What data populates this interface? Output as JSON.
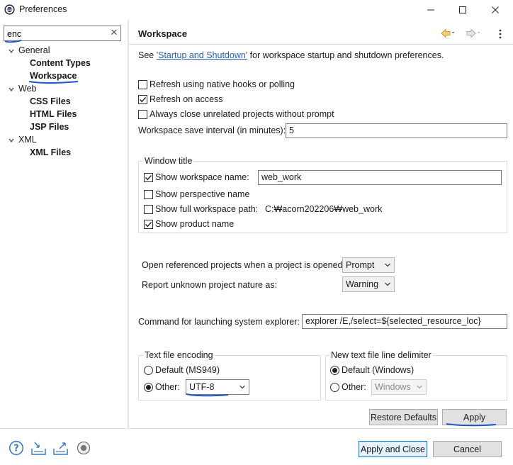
{
  "window": {
    "title": "Preferences",
    "controls": {
      "minimize": "minimize",
      "maximize": "maximize",
      "close": "close"
    }
  },
  "sidebar": {
    "filter_value": "enc",
    "tree": [
      {
        "label": "General",
        "expanded": true,
        "children": [
          "Content Types",
          "Workspace"
        ]
      },
      {
        "label": "Web",
        "expanded": true,
        "children": [
          "CSS Files",
          "HTML Files",
          "JSP Files"
        ]
      },
      {
        "label": "XML",
        "expanded": true,
        "children": [
          "XML Files"
        ]
      }
    ],
    "selected": "Workspace"
  },
  "page": {
    "title": "Workspace",
    "description": {
      "prefix": "See ",
      "link": "'Startup and Shutdown'",
      "suffix": " for workspace startup and shutdown preferences."
    },
    "options": {
      "refresh_native": {
        "label": "Refresh using native hooks or polling",
        "checked": false
      },
      "refresh_access": {
        "label": "Refresh on access",
        "checked": true
      },
      "always_close": {
        "label": "Always close unrelated projects without prompt",
        "checked": false
      }
    },
    "save_interval": {
      "label": "Workspace save interval (in minutes):",
      "value": "5"
    },
    "window_title": {
      "group_label": "Window title",
      "show_workspace_name": {
        "label": "Show workspace name:",
        "checked": true,
        "value": "web_work"
      },
      "show_perspective_name": {
        "label": "Show perspective name",
        "checked": false
      },
      "show_full_path": {
        "label": "Show full workspace path:",
        "checked": false,
        "value": "C:₩acorn202206₩web_work"
      },
      "show_product_name": {
        "label": "Show product name",
        "checked": true
      }
    },
    "open_referenced": {
      "label": "Open referenced projects when a project is opened:",
      "value": "Prompt"
    },
    "unknown_nature": {
      "label": "Report unknown project nature as:",
      "value": "Warning"
    },
    "system_explorer": {
      "label": "Command for launching system explorer:",
      "value": "explorer /E,/select=${selected_resource_loc}"
    },
    "encoding": {
      "group_label": "Text file encoding",
      "default_label": "Default (MS949)",
      "other_label": "Other:",
      "selected": "other",
      "other_value": "UTF-8"
    },
    "line_delimiter": {
      "group_label": "New text file line delimiter",
      "default_label": "Default (Windows)",
      "other_label": "Other:",
      "selected": "default",
      "other_value": "Windows"
    },
    "restore_defaults": "Restore Defaults",
    "apply": "Apply"
  },
  "footer": {
    "apply_and_close": "Apply and Close",
    "cancel": "Cancel",
    "icons": [
      "help-icon",
      "import-icon",
      "export-icon",
      "record-icon"
    ]
  },
  "colors": {
    "annotation_ink": "#1a56c8",
    "link": "#2a5db0",
    "default_button_border": "#0078d7",
    "nav_arrow": "#e8b84a"
  }
}
